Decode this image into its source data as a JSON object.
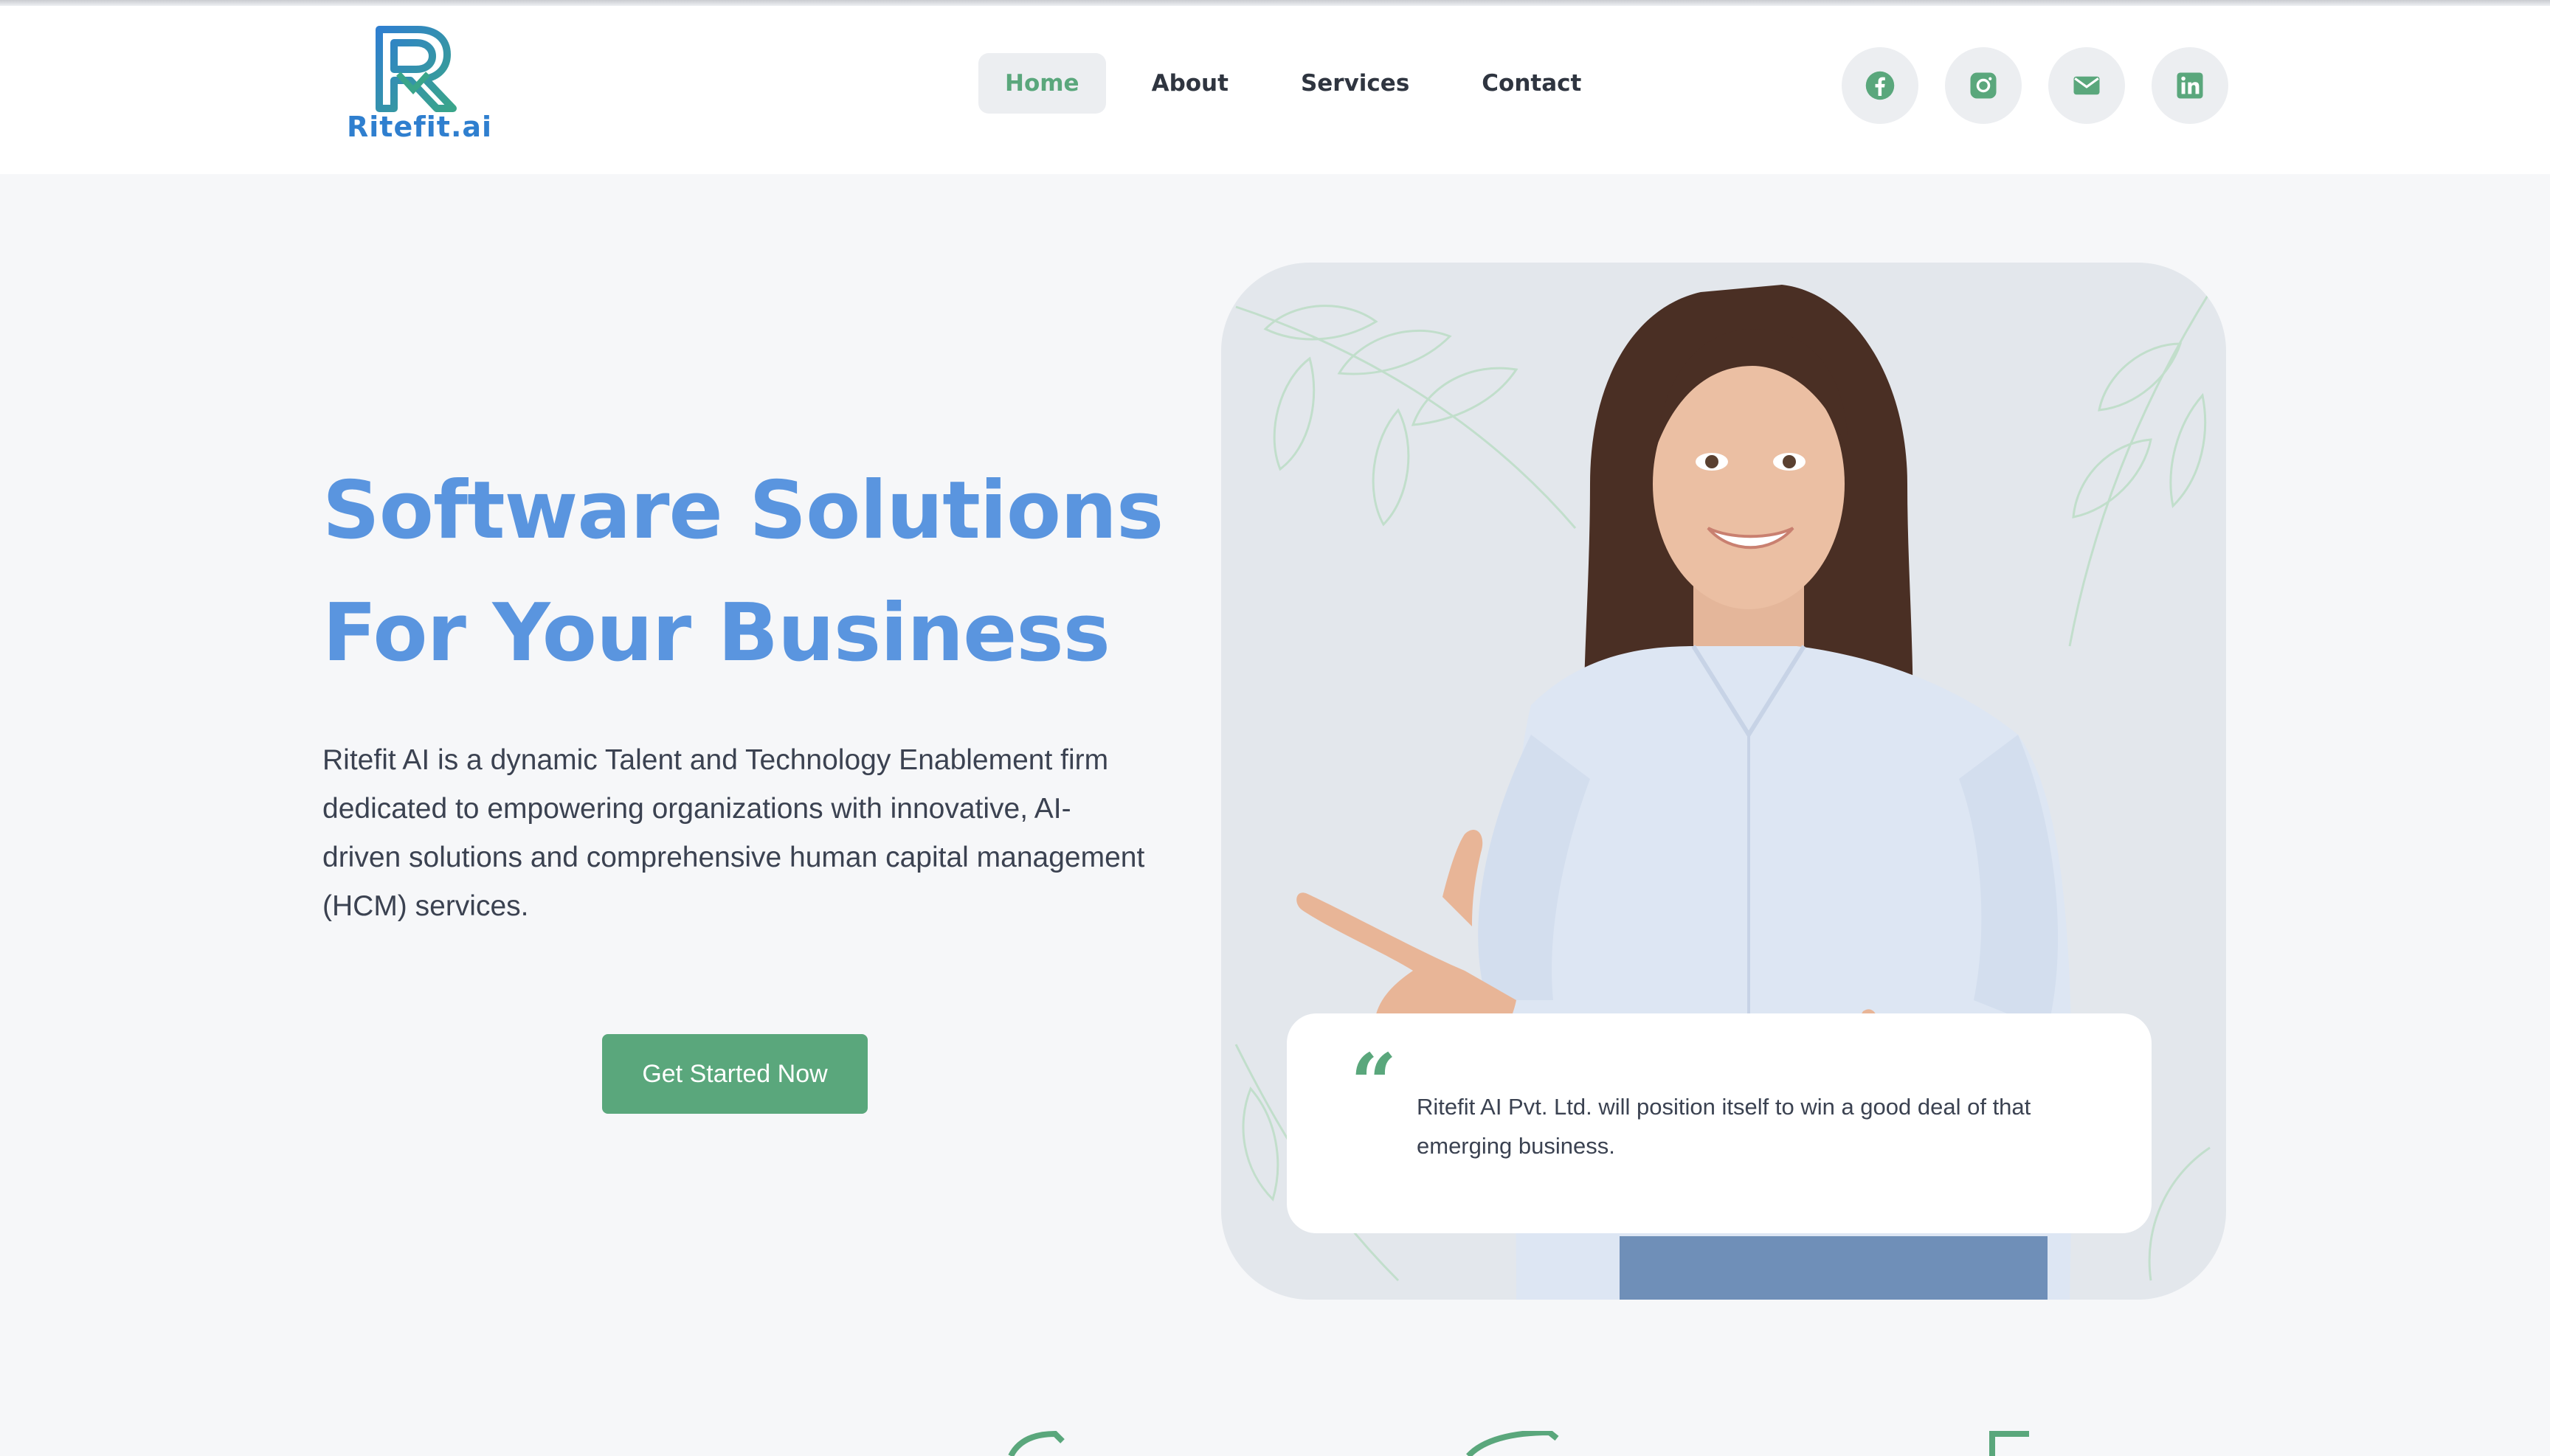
{
  "brand": {
    "logo_text": "Ritefit.ai",
    "accent": "#5aa77c",
    "primary_blue": "#5a95df",
    "logo_blue": "#2f7fcf"
  },
  "nav": {
    "items": [
      {
        "label": "Home",
        "active": true
      },
      {
        "label": "About",
        "active": false
      },
      {
        "label": "Services",
        "active": false
      },
      {
        "label": "Contact",
        "active": false
      }
    ]
  },
  "socials": [
    {
      "icon": "facebook-icon"
    },
    {
      "icon": "instagram-icon"
    },
    {
      "icon": "mail-icon"
    },
    {
      "icon": "linkedin-icon"
    }
  ],
  "hero": {
    "title_line1": "Software Solutions",
    "title_line2": "For Your Business",
    "description": "Ritefit AI is a dynamic Talent and Technology Enablement firm dedicated to empowering organizations with innovative, AI-driven solutions and comprehensive human capital management (HCM) services.",
    "cta_label": "Get Started Now"
  },
  "testimonial": {
    "icon": "quote-icon",
    "quote_glyph": "“",
    "text": "Ritefit AI Pvt. Ltd. will position itself to win a good deal of that emerging business."
  }
}
